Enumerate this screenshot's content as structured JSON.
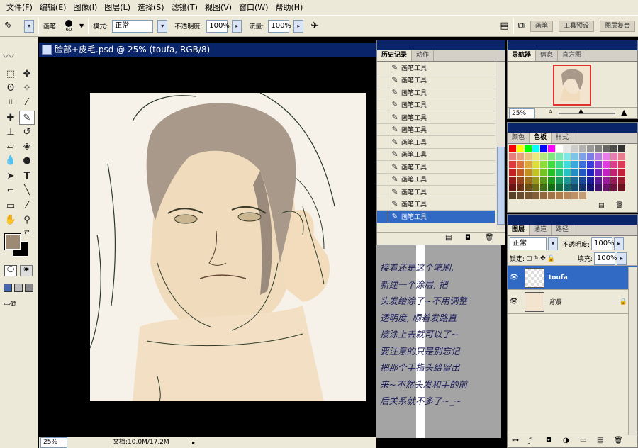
{
  "menubar": {
    "items": [
      "文件(F)",
      "编辑(E)",
      "图像(I)",
      "图层(L)",
      "选择(S)",
      "滤镜(T)",
      "视图(V)",
      "窗口(W)",
      "帮助(H)"
    ]
  },
  "options": {
    "brush_label": "画笔:",
    "brush_size": "60",
    "mode_label": "模式:",
    "mode_value": "正常",
    "opacity_label": "不透明度:",
    "opacity_value": "100%",
    "flow_label": "流量:",
    "flow_value": "100%",
    "workspace_tabs": [
      "画笔",
      "工具预设",
      "图层复合"
    ]
  },
  "document": {
    "title": "脸部+皮毛.psd @ 25% (toufa, RGB/8)",
    "zoom": "25%",
    "doc_size": "文档:10.0M/17.2M"
  },
  "history": {
    "tabs": [
      "历史记录",
      "动作"
    ],
    "items": [
      "画笔工具",
      "画笔工具",
      "画笔工具",
      "画笔工具",
      "画笔工具",
      "画笔工具",
      "画笔工具",
      "画笔工具",
      "画笔工具",
      "画笔工具",
      "画笔工具",
      "画笔工具",
      "画笔工具"
    ]
  },
  "note": {
    "text": "接着还是这个笔刷,\n新建一个涂层, 把\n头发给涂了~不用调整\n透明度, 顺着发路直\n接涂上去就可以了~\n要注意的只是别忘记\n把那个手指头给留出\n来~不然头发和手的前\n后关系就不多了~_~"
  },
  "navigator": {
    "tabs": [
      "导航器",
      "信息",
      "直方图"
    ],
    "zoom": "25%"
  },
  "swatches": {
    "tabs": [
      "颜色",
      "色板",
      "样式"
    ]
  },
  "layers": {
    "tabs": [
      "图层",
      "通道",
      "路径"
    ],
    "blend_mode": "正常",
    "opacity_label": "不透明度:",
    "opacity_value": "100%",
    "lock_label": "锁定:",
    "fill_label": "填充:",
    "fill_value": "100%",
    "items": [
      {
        "name": "toufa",
        "selected": true
      },
      {
        "name": "背景",
        "selected": false
      }
    ]
  },
  "colors": {
    "foreground": "#9c8a74",
    "background": "#000000",
    "title_bar": "#0a246a",
    "selection": "#316ac5"
  }
}
